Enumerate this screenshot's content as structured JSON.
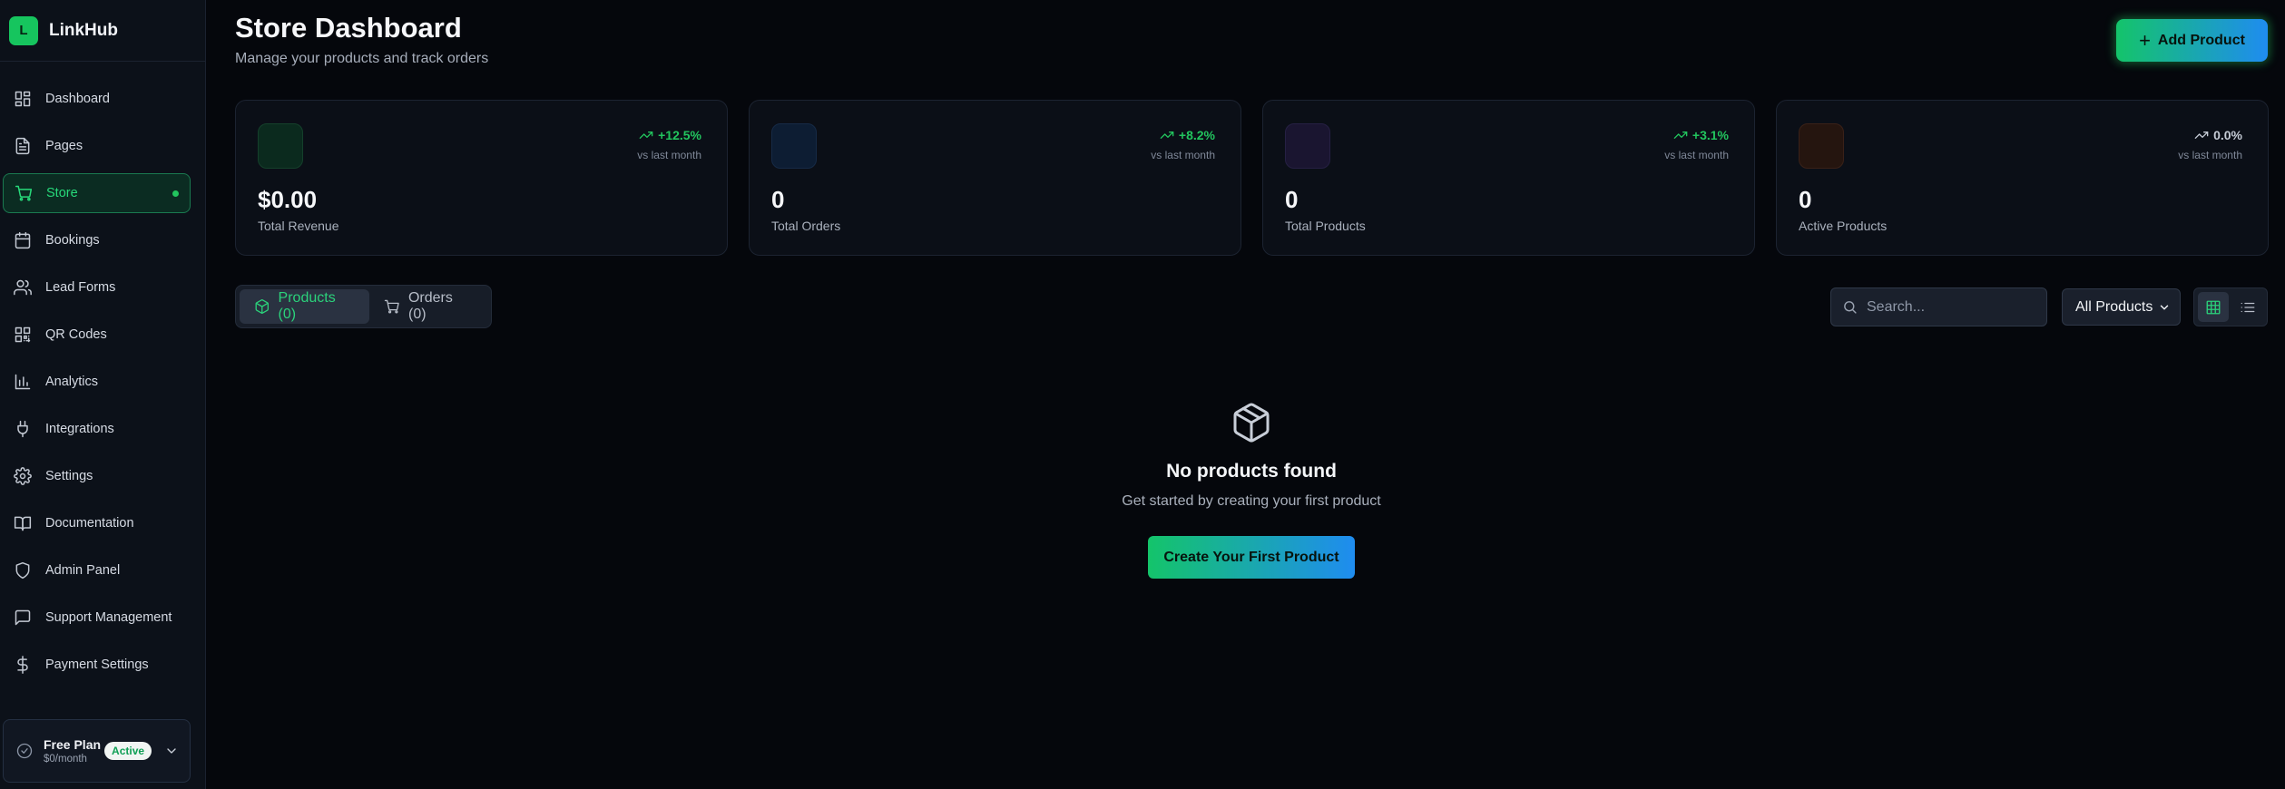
{
  "brand": {
    "logo_letter": "L",
    "name": "LinkHub"
  },
  "sidebar": {
    "items": [
      {
        "label": "Dashboard",
        "icon": "dashboard-icon"
      },
      {
        "label": "Pages",
        "icon": "document-icon"
      },
      {
        "label": "Store",
        "icon": "cart-icon",
        "active": true
      },
      {
        "label": "Bookings",
        "icon": "calendar-icon"
      },
      {
        "label": "Lead Forms",
        "icon": "users-icon"
      },
      {
        "label": "QR Codes",
        "icon": "qr-code-icon"
      },
      {
        "label": "Analytics",
        "icon": "bar-chart-icon"
      },
      {
        "label": "Integrations",
        "icon": "plug-icon"
      },
      {
        "label": "Settings",
        "icon": "gear-icon"
      },
      {
        "label": "Documentation",
        "icon": "book-icon"
      },
      {
        "label": "Admin Panel",
        "icon": "shield-icon"
      },
      {
        "label": "Support Management",
        "icon": "chat-icon"
      },
      {
        "label": "Payment Settings",
        "icon": "dollar-icon"
      }
    ],
    "plan": {
      "name": "Free Plan",
      "price": "$0/month",
      "badge": "Active"
    }
  },
  "header": {
    "title": "Store Dashboard",
    "subtitle": "Manage your products and track orders",
    "add_button": "Add Product"
  },
  "stats": [
    {
      "value": "$0.00",
      "label": "Total Revenue",
      "trend": "+12.5%",
      "vs": "vs last month",
      "trend_color": "#22c55e",
      "icon_bg": "#0b2a1e",
      "icon_border": "#15402b"
    },
    {
      "value": "0",
      "label": "Total Orders",
      "trend": "+8.2%",
      "vs": "vs last month",
      "trend_color": "#22c55e",
      "icon_bg": "#0d1d33",
      "icon_border": "#162a46"
    },
    {
      "value": "0",
      "label": "Total Products",
      "trend": "+3.1%",
      "vs": "vs last month",
      "trend_color": "#22c55e",
      "icon_bg": "#1a1530",
      "icon_border": "#262043"
    },
    {
      "value": "0",
      "label": "Active Products",
      "trend": "0.0%",
      "vs": "vs last month",
      "trend_color": "#c5cbd5",
      "icon_bg": "#25150f",
      "icon_border": "#3a2118"
    }
  ],
  "tabs": [
    {
      "label": "Products (0)",
      "icon": "box-icon",
      "active": true
    },
    {
      "label": "Orders (0)",
      "icon": "cart-icon",
      "active": false
    }
  ],
  "search": {
    "placeholder": "Search..."
  },
  "filter": {
    "selected": "All Products"
  },
  "empty_state": {
    "title": "No products found",
    "subtitle": "Get started by creating your first product",
    "button": "Create Your First Product"
  },
  "colors": {
    "accent": "#22c55e",
    "gradient_end": "#1f8cf0",
    "background": "#05070c"
  }
}
